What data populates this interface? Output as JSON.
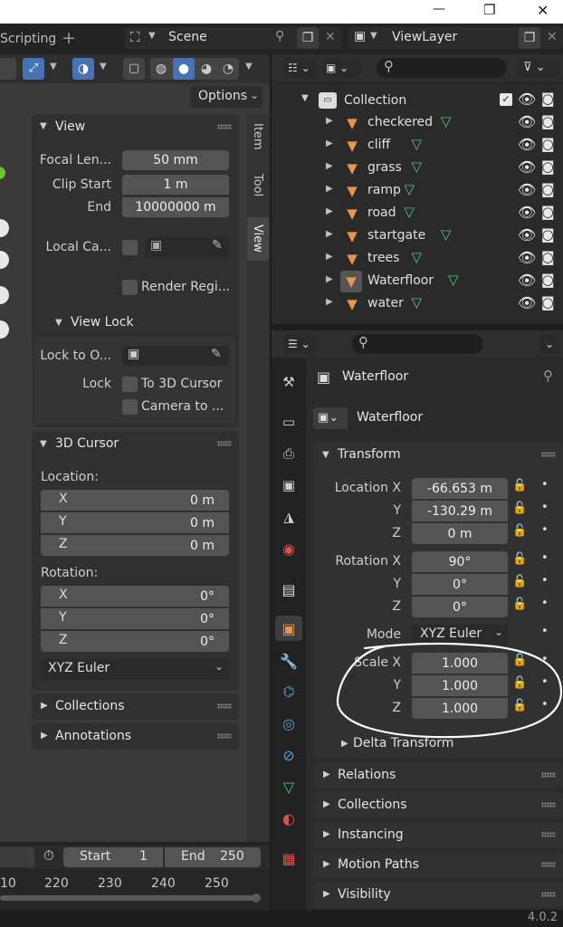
{
  "window": {
    "minimize": "—",
    "maximize": "❐",
    "close": "✕"
  },
  "topbar": {
    "workspace_tab": "Scripting",
    "add_tab": "+",
    "scene_name": "Scene",
    "viewlayer_name": "ViewLayer"
  },
  "viewport": {
    "options_label": "Options",
    "side_tabs": [
      "Item",
      "Tool",
      "View"
    ],
    "view_panel": {
      "title": "View",
      "focal_label": "Focal Len...",
      "focal_value": "50 mm",
      "clip_start_label": "Clip Start",
      "clip_start_value": "1 m",
      "clip_end_label": "End",
      "clip_end_value": "10000000 m",
      "local_camera_label": "Local Ca...",
      "render_region_label": "Render Regi...",
      "view_lock_title": "View Lock",
      "lock_to_object_label": "Lock to O...",
      "lock_label": "Lock",
      "to_3d_cursor_label": "To 3D Cursor",
      "camera_to_label": "Camera to ..."
    },
    "cursor_panel": {
      "title": "3D Cursor",
      "location_label": "Location:",
      "loc": [
        {
          "axis": "X",
          "value": "0 m"
        },
        {
          "axis": "Y",
          "value": "0 m"
        },
        {
          "axis": "Z",
          "value": "0 m"
        }
      ],
      "rotation_label": "Rotation:",
      "rot": [
        {
          "axis": "X",
          "value": "0°"
        },
        {
          "axis": "Y",
          "value": "0°"
        },
        {
          "axis": "Z",
          "value": "0°"
        }
      ],
      "rotation_mode": "XYZ Euler"
    },
    "collections_panel": "Collections",
    "annotations_panel": "Annotations"
  },
  "timeline": {
    "start_label": "Start",
    "start_value": "1",
    "end_label": "End",
    "end_value": "250",
    "ticks": [
      "10",
      "220",
      "230",
      "240",
      "250"
    ]
  },
  "outliner": {
    "search_placeholder": "",
    "collection": "Collection",
    "objects": [
      "checkered",
      "cliff",
      "grass",
      "ramp",
      "road",
      "startgate",
      "trees",
      "Waterfloor",
      "water"
    ],
    "selected": "Waterfloor"
  },
  "properties": {
    "search_placeholder": "",
    "object_name": "Waterfloor",
    "datablock_name": "Waterfloor",
    "transform_title": "Transform",
    "location_x_label": "Location X",
    "location_x": "-66.653 m",
    "location_y_label": "Y",
    "location_y": "-130.29 m",
    "location_z_label": "Z",
    "location_z": "0 m",
    "rotation_x_label": "Rotation X",
    "rotation_x": "90°",
    "rotation_y_label": "Y",
    "rotation_y": "0°",
    "rotation_z_label": "Z",
    "rotation_z": "0°",
    "mode_label": "Mode",
    "mode_value": "XYZ Euler",
    "scale_x_label": "Scale X",
    "scale_x": "1.000",
    "scale_y_label": "Y",
    "scale_y": "1.000",
    "scale_z_label": "Z",
    "scale_z": "1.000",
    "delta_transform": "Delta Transform",
    "panels": [
      "Relations",
      "Collections",
      "Instancing",
      "Motion Paths",
      "Visibility"
    ]
  },
  "status": {
    "version": "4.0.2"
  },
  "colors": {
    "accent": "#4772b3",
    "object_orange": "#e8974a",
    "mesh_green": "#4fc68a",
    "viewport_bg": "#3a3a3a"
  }
}
